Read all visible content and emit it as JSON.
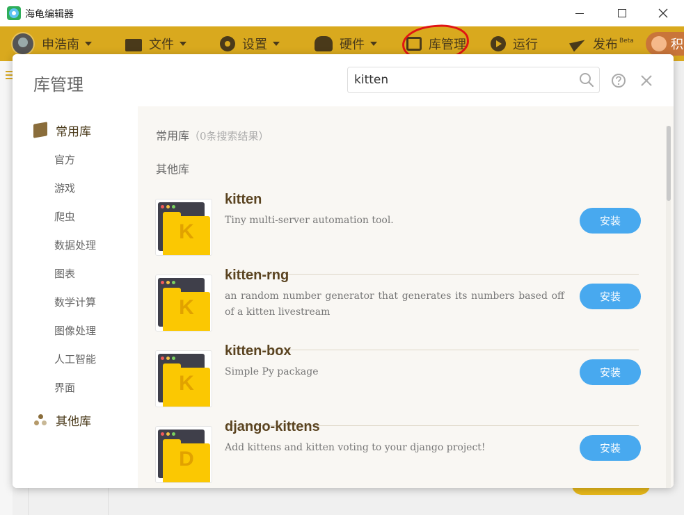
{
  "window": {
    "title": "海龟编辑器"
  },
  "toolbar": {
    "user": "申浩南",
    "file": "文件",
    "settings": "设置",
    "hardware": "硬件",
    "library": "库管理",
    "run": "运行",
    "publish": "发布",
    "publish_badge": "Beta",
    "right_pill": "积"
  },
  "modal": {
    "title": "库管理",
    "search_value": "kitten",
    "sidebar": {
      "common_label": "常用库",
      "common_items": [
        "官方",
        "游戏",
        "爬虫",
        "数据处理",
        "图表",
        "数学计算",
        "图像处理",
        "人工智能",
        "界面"
      ],
      "other_label": "其他库"
    },
    "sections": {
      "common_title": "常用库",
      "common_result": "（0条搜索结果）",
      "other_title": "其他库"
    },
    "packages": [
      {
        "name": "kitten",
        "letter": "K",
        "description": "Tiny multi-server automation tool.",
        "button": "安装"
      },
      {
        "name": "kitten-rng",
        "letter": "K",
        "description": "an random number generator that generates its numbers based off of a kitten livestream",
        "button": "安装"
      },
      {
        "name": "kitten-box",
        "letter": "K",
        "description": "Simple Py package",
        "button": "安装"
      },
      {
        "name": "django-kittens",
        "letter": "D",
        "description": "Add kittens and kitten voting to your django project!",
        "button": "安装"
      }
    ]
  },
  "colors": {
    "toolbar_bg": "#d9a91e",
    "install_button": "#48a9ef",
    "package_name": "#5a4320",
    "folder_yellow": "#fbc802",
    "annotation_red": "#e01414"
  }
}
